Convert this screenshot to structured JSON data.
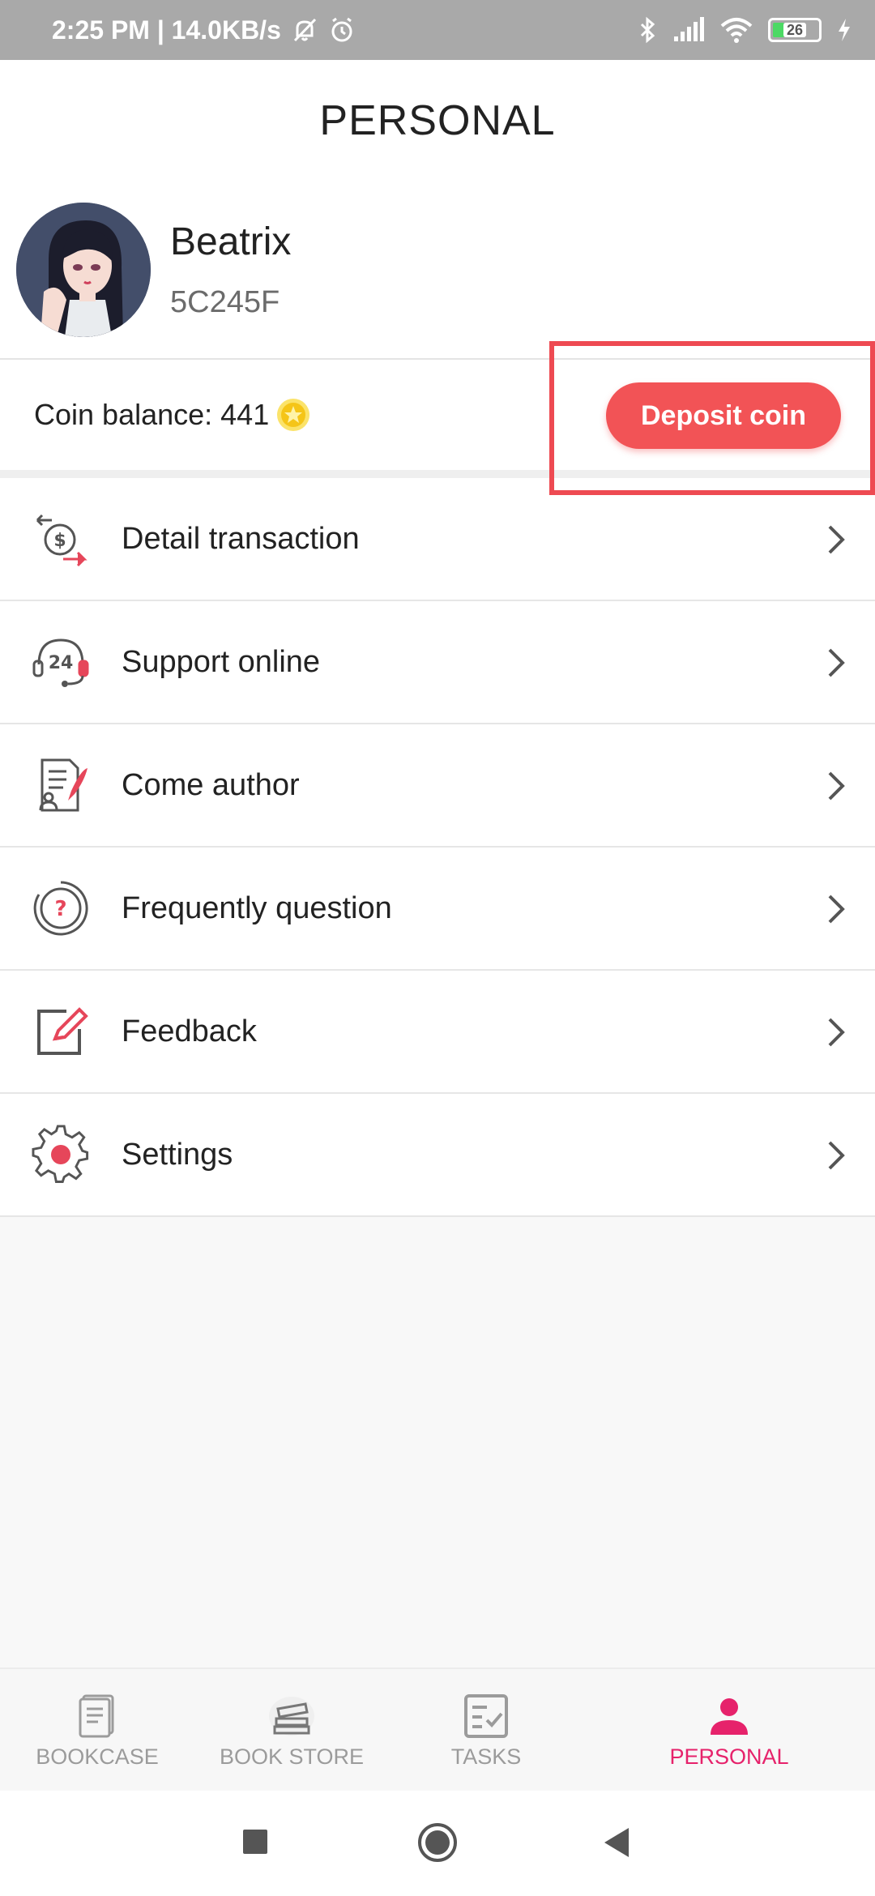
{
  "status_bar": {
    "time_speed": "2:25 PM | 14.0KB/s",
    "battery_level": "26",
    "icons": [
      "mute-icon",
      "alarm-icon",
      "bluetooth-icon",
      "signal-icon",
      "wifi-icon",
      "battery-icon",
      "charging-icon"
    ]
  },
  "header": {
    "title": "PERSONAL"
  },
  "profile": {
    "name": "Beatrix",
    "id": "5C245F"
  },
  "balance": {
    "label": "Coin balance: 441",
    "deposit_label": "Deposit coin"
  },
  "menu": {
    "items": [
      {
        "label": "Detail transaction",
        "icon": "transaction-icon"
      },
      {
        "label": "Support online",
        "icon": "support-24-icon"
      },
      {
        "label": "Come author",
        "icon": "author-icon"
      },
      {
        "label": "Frequently question",
        "icon": "question-icon"
      },
      {
        "label": "Feedback",
        "icon": "feedback-icon"
      },
      {
        "label": "Settings",
        "icon": "settings-icon"
      }
    ]
  },
  "tabbar": {
    "tabs": [
      {
        "label": "BOOKCASE",
        "icon": "bookcase-icon"
      },
      {
        "label": "BOOK STORE",
        "icon": "bookstore-icon"
      },
      {
        "label": "TASKS",
        "icon": "tasks-icon"
      },
      {
        "label": "PERSONAL",
        "icon": "person-icon",
        "active": true
      }
    ]
  },
  "colors": {
    "accent": "#f25356",
    "active_tab": "#e6226b",
    "coin": "#f5c518"
  }
}
